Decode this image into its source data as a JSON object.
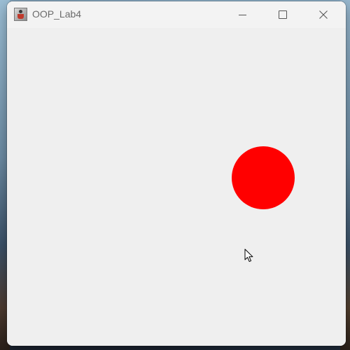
{
  "window": {
    "title": "OOP_Lab4",
    "app_icon": "java-app-icon"
  },
  "titlebar_controls": {
    "minimize_icon": "minimize-icon",
    "maximize_icon": "maximize-icon",
    "close_icon": "close-icon"
  },
  "canvas": {
    "background_color": "#efefef",
    "ball_color": "#ff0000",
    "ball_icon": "red-circle"
  },
  "pointer": {
    "icon": "mouse-cursor-icon"
  }
}
